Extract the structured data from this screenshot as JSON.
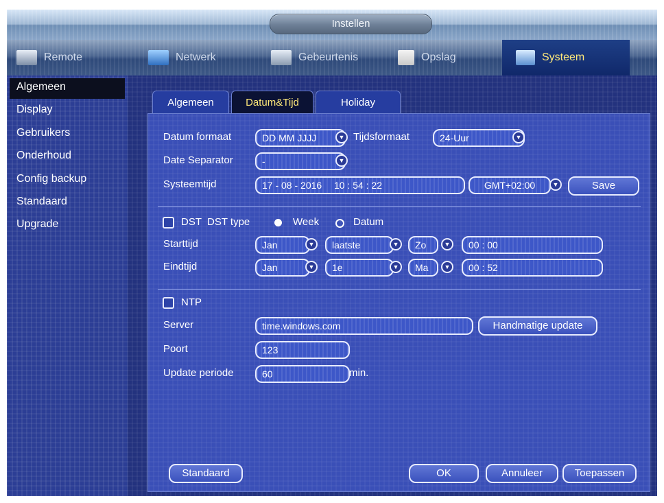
{
  "window": {
    "title": "Instellen"
  },
  "main_tabs": [
    {
      "label": "Remote",
      "icon": "camera-icon"
    },
    {
      "label": "Netwerk",
      "icon": "network-icon"
    },
    {
      "label": "Gebeurtenis",
      "icon": "event-icon"
    },
    {
      "label": "Opslag",
      "icon": "storage-icon"
    },
    {
      "label": "Systeem",
      "icon": "system-icon",
      "active": true
    }
  ],
  "sidebar": {
    "items": [
      {
        "label": "Algemeen",
        "active": true
      },
      {
        "label": "Display"
      },
      {
        "label": "Gebruikers"
      },
      {
        "label": "Onderhoud"
      },
      {
        "label": "Config backup"
      },
      {
        "label": "Standaard"
      },
      {
        "label": "Upgrade"
      }
    ]
  },
  "sub_tabs": [
    {
      "label": "Algemeen"
    },
    {
      "label": "Datum&Tijd",
      "active": true
    },
    {
      "label": "Holiday"
    }
  ],
  "form": {
    "date_format_label": "Datum formaat",
    "date_format_value": "DD MM JJJJ",
    "time_format_label": "Tijdsformaat",
    "time_format_value": "24-Uur",
    "separator_label": "Date Separator",
    "separator_value": "-",
    "system_time_label": "Systeemtijd",
    "system_time_date": "17 - 08 - 2016",
    "system_time_time": "10 : 54 : 22",
    "timezone_value": "GMT+02:00",
    "save_label": "Save"
  },
  "dst": {
    "label": "DST",
    "type_label": "DST type",
    "option_week": "Week",
    "option_date": "Datum",
    "start_label": "Starttijd",
    "start_month": "Jan",
    "start_week": "laatste",
    "start_day": "Zo",
    "start_time": "00 :  00",
    "end_label": "Eindtijd",
    "end_month": "Jan",
    "end_week": "1e",
    "end_day": "Ma",
    "end_time": "00 :  52"
  },
  "ntp": {
    "label": "NTP",
    "server_label": "Server",
    "server_value": "time.windows.com",
    "manual_update_label": "Handmatige update",
    "port_label": "Poort",
    "port_value": "123",
    "period_label": "Update periode",
    "period_value": "60",
    "period_unit": "min."
  },
  "footer": {
    "default_label": "Standaard",
    "ok_label": "OK",
    "cancel_label": "Annuleer",
    "apply_label": "Toepassen"
  },
  "colors": {
    "active_text": "#ffe97a",
    "panel_bg": "#3a4fb7",
    "sidebar_bg": "#2c3e95"
  }
}
